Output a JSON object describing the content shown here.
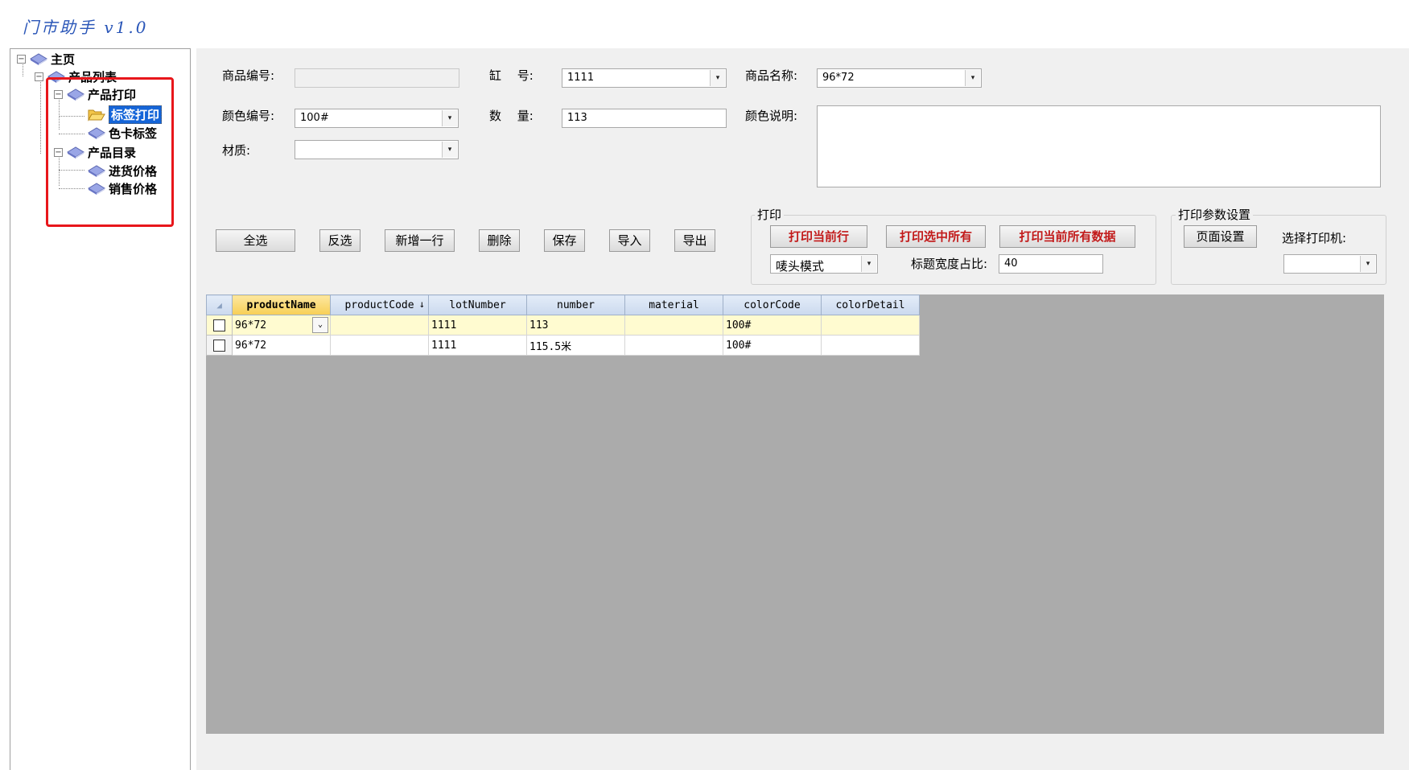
{
  "app": {
    "title": "门市助手 v1.0"
  },
  "tree": {
    "root": "主页",
    "product_list": "产品列表",
    "product_print": "产品打印",
    "label_print": "标签打印",
    "color_card_label": "色卡标签",
    "product_catalog": "产品目录",
    "purchase_price": "进货价格",
    "sale_price": "销售价格",
    "expand_symbol": "−"
  },
  "form": {
    "product_code_label": "商品编号:",
    "product_code_value": "",
    "lot_label": "缸　 号:",
    "lot_value": "1111",
    "product_name_label": "商品名称:",
    "product_name_value": "96*72",
    "color_code_label": "颜色编号:",
    "color_code_value": "100#",
    "quantity_label": "数　 量:",
    "quantity_value": "113",
    "color_desc_label": "颜色说明:",
    "color_desc_value": "",
    "material_label": "材质:",
    "material_value": ""
  },
  "toolbar": {
    "select_all": "全选",
    "invert": "反选",
    "add_row": "新增一行",
    "delete": "删除",
    "save": "保存",
    "import": "导入",
    "export": "导出"
  },
  "print_group": {
    "title": "打印",
    "print_current": "打印当前行",
    "print_selected": "打印选中所有",
    "print_all": "打印当前所有数据",
    "mode_value": "唛头模式",
    "title_ratio_label": "标题宽度占比:",
    "title_ratio_value": "40"
  },
  "print_settings": {
    "title": "打印参数设置",
    "page_setup": "页面设置",
    "choose_printer_label": "选择打印机:",
    "printer_value": ""
  },
  "grid": {
    "columns": [
      "productName",
      "productCode",
      "lotNumber",
      "number",
      "material",
      "colorCode",
      "colorDetail"
    ],
    "sort_indicator": "↓",
    "rows": [
      {
        "productName": "96*72",
        "productCode": "",
        "lotNumber": "1111",
        "number": "113",
        "material": "",
        "colorCode": "100#",
        "colorDetail": ""
      },
      {
        "productName": "96*72",
        "productCode": "",
        "lotNumber": "1111",
        "number": "115.5米",
        "material": "",
        "colorCode": "100#",
        "colorDetail": ""
      }
    ]
  },
  "icons": {
    "dropdown": "▾",
    "cell_dropdown": "⌄",
    "grid_corner": "◢"
  },
  "colors": {
    "accent_red": "#c21a1a",
    "highlight_box": "#e8161b",
    "selection_blue": "#1565d8",
    "title_blue": "#2a56b8",
    "grid_empty": "#ababab"
  }
}
